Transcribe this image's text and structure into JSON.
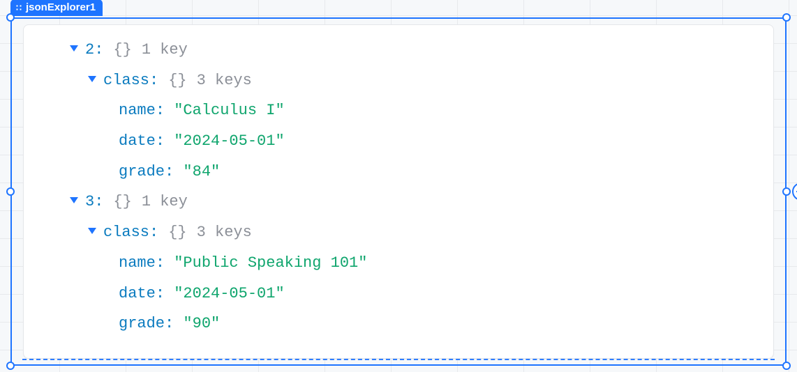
{
  "component": {
    "name": "jsonExplorer1"
  },
  "labels": {
    "key_suffix_singular": "key",
    "key_suffix_plural": "keys"
  },
  "tree": {
    "item2": {
      "index_label": "2",
      "braces": "{}",
      "key_count": "1",
      "key_count_suffix": "key",
      "class_label": "class",
      "class_braces": "{}",
      "class_key_count": "3",
      "class_key_count_suffix": "keys",
      "fields": {
        "name_key": "name",
        "name_val": "\"Calculus I\"",
        "date_key": "date",
        "date_val": "\"2024-05-01\"",
        "grade_key": "grade",
        "grade_val": "\"84\""
      }
    },
    "item3": {
      "index_label": "3",
      "braces": "{}",
      "key_count": "1",
      "key_count_suffix": "key",
      "class_label": "class",
      "class_braces": "{}",
      "class_key_count": "3",
      "class_key_count_suffix": "keys",
      "fields": {
        "name_key": "name",
        "name_val": "\"Public Speaking 101\"",
        "date_key": "date",
        "date_val": "\"2024-05-01\"",
        "grade_key": "grade",
        "grade_val": "\"90\""
      }
    }
  }
}
